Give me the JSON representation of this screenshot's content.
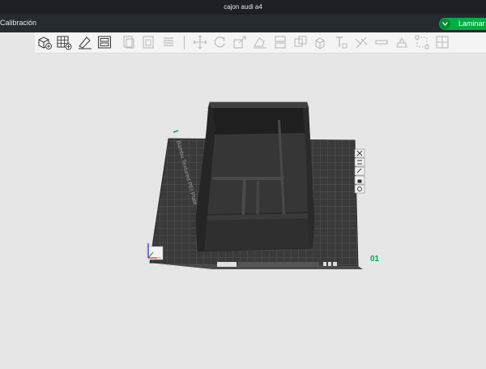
{
  "window": {
    "title": "cajon audi a4"
  },
  "menubar": {
    "tab_label": "Calibración",
    "slice_button_label": "Laminar"
  },
  "toolbar": {
    "icons": [
      "add-object-icon",
      "add-plate-icon",
      "auto-orient-icon",
      "arrange-icon",
      "copy-icon",
      "paste-icon",
      "layers-icon",
      "move-icon",
      "rotate-icon",
      "scale-icon",
      "lay-on-face-icon",
      "split-icon",
      "cut-icon",
      "boolean-icon",
      "support-paint-icon",
      "text-icon",
      "seam-paint-icon",
      "color-paint-icon",
      "measure-icon",
      "assembly-icon"
    ]
  },
  "plate": {
    "label": "Bambu Textured PEI Plate",
    "number": "01",
    "side_icons": [
      "close-plate-icon",
      "arrange-plate-icon",
      "orient-plate-icon",
      "lock-plate-icon",
      "plate-settings-icon"
    ]
  },
  "colors": {
    "titlebar": "#1c2024",
    "menubar": "#262b30",
    "accent": "#00ae42",
    "plate": "#3a3a3a",
    "model": "#2e2e2e"
  }
}
